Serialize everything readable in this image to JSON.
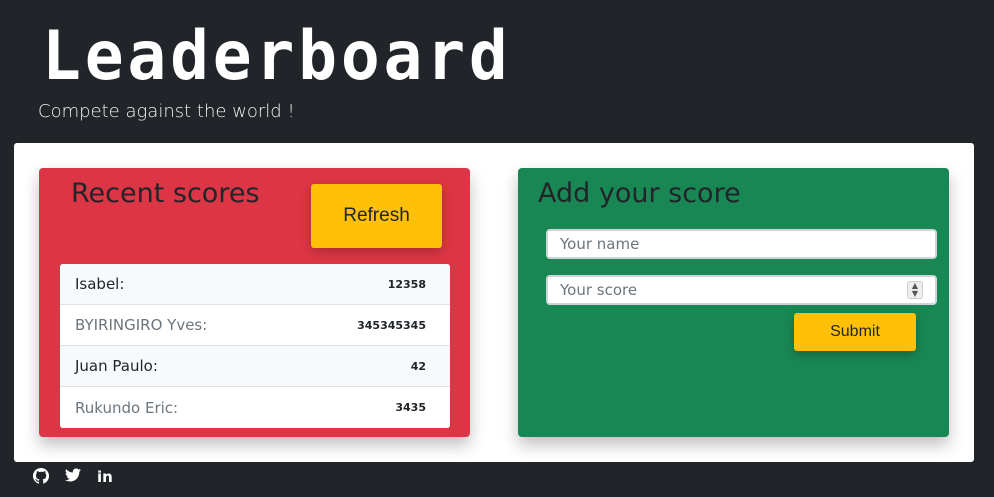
{
  "header": {
    "title": "Leaderboard",
    "subtitle": "Compete against the world !"
  },
  "recent": {
    "heading": "Recent scores",
    "refresh_label": "Refresh",
    "scores": [
      {
        "name": "Isabel:",
        "score": "12358"
      },
      {
        "name": "BYIRINGIRO Yves:",
        "score": "345345345"
      },
      {
        "name": "Juan Paulo:",
        "score": "42"
      },
      {
        "name": "Rukundo Eric:",
        "score": "3435"
      }
    ]
  },
  "add": {
    "heading": "Add your score",
    "name_placeholder": "Your name",
    "score_placeholder": "Your score",
    "submit_label": "Submit"
  },
  "footer": {
    "icons": [
      "github-icon",
      "twitter-icon",
      "linkedin-icon"
    ],
    "linkedin_text": "in"
  }
}
